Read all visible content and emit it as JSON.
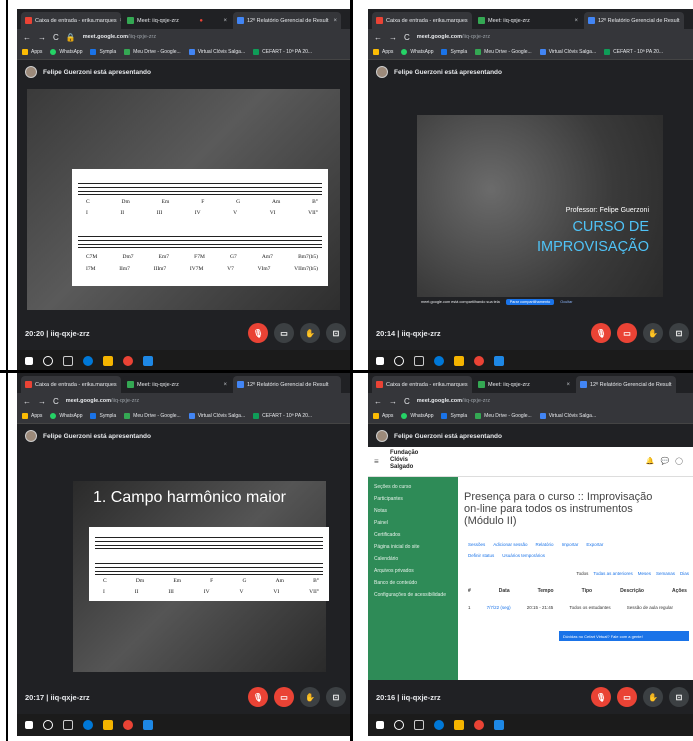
{
  "browser": {
    "tabs": [
      "Caixa de entrada - erika.marques",
      "Meet: iiq-qxje-zrz",
      "12º Relatório Gerencial de Result"
    ],
    "url_host": "meet.google.com",
    "url_path": "/iiq-qxje-zrz",
    "bookmarks": [
      "Apps",
      "WhatsApp",
      "Sympla",
      "Meu Drive - Google...",
      "Virtual Clóvis Salga...",
      "CEFART - 10ª PA 20...",
      "H"
    ]
  },
  "presenter": "Felipe Guerzoni está apresentando",
  "meeting_code": "iiq-qxje-zrz",
  "panels": [
    {
      "time": "20:20"
    },
    {
      "time": "20:14"
    },
    {
      "time": "20:17"
    },
    {
      "time": "20:16"
    }
  ],
  "score1": {
    "top_chords": [
      "C",
      "Dm",
      "Em",
      "F",
      "G",
      "Am",
      "B°"
    ],
    "top_degrees": [
      "I",
      "II",
      "III",
      "IV",
      "V",
      "VI",
      "VII°"
    ],
    "bottom_chords": [
      "C7M",
      "Dm7",
      "Em7",
      "F7M",
      "G7",
      "Am7",
      "Bm7(b5)"
    ],
    "bottom_degrees": [
      "I7M",
      "IIm7",
      "IIIm7",
      "IV7M",
      "V7",
      "VIm7",
      "VIIm7(b5)"
    ]
  },
  "course_slide": {
    "professor": "Professor: Felipe Guerzoni",
    "line1": "CURSO DE",
    "line2": "IMPROVISAÇÃO",
    "share_text": "meet.google.com está compartilhando sua tela",
    "stop_share": "Parar compartilhamento",
    "hide": "Ocultar"
  },
  "slide3": {
    "title": "1. Campo harmônico maior",
    "chords": [
      "C",
      "Dm",
      "Em",
      "F",
      "G",
      "Am",
      "B°"
    ],
    "degrees": [
      "I",
      "II",
      "III",
      "IV",
      "V",
      "VI",
      "VII°"
    ]
  },
  "moodle": {
    "brand": [
      "Fundação",
      "Clóvis",
      "Salgado"
    ],
    "menu": [
      "Seções do curso",
      "Participantes",
      "Notas",
      "Painel",
      "Certificados",
      "Página inicial do site",
      "Calendário",
      "Arquivos privados",
      "Banco de conteúdo",
      "Configurações de acessibilidade"
    ],
    "heading": "Presença para o curso :: Improvisação on-line para todos os instrumentos (Módulo II)",
    "tabs": [
      "Sessões",
      "Adicionar sessão",
      "Relatório",
      "Importar",
      "Exportar"
    ],
    "links": [
      "Definir status",
      "Usuários temporários"
    ],
    "filters": [
      "Todos",
      "Todas as anteriores",
      "Meses",
      "Semanas",
      "Dias"
    ],
    "columns": [
      "#",
      "Data",
      "Tempo",
      "Tipo",
      "Descrição",
      "Ações"
    ],
    "row": [
      "1",
      "7/7/22 (seg)",
      "20:15 - 21:45",
      "Todos os estudantes",
      "Sessão de aula regular"
    ],
    "chat": "Dúvidas no Cefart Virtual? Fale com a gente!"
  }
}
